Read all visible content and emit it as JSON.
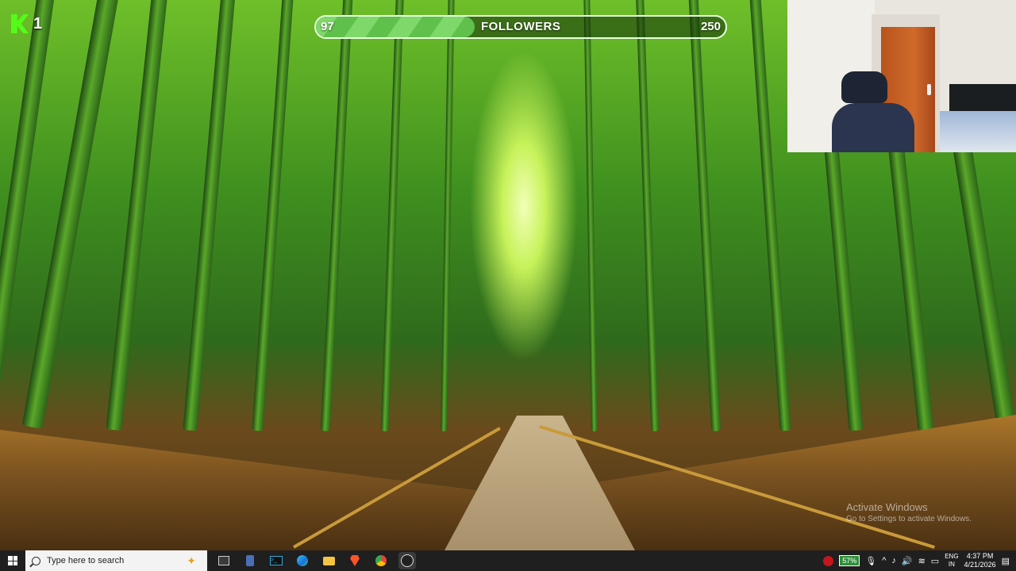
{
  "overlay": {
    "ticker_count": "1",
    "follower_goal": {
      "current": "97",
      "label": "FOLLOWERS",
      "target": "250",
      "progress_fraction": 0.388
    }
  },
  "watermark": {
    "title": "Activate Windows",
    "subtitle": "Go to Settings to activate Windows."
  },
  "taskbar": {
    "search_placeholder": "Type here to search",
    "pinned_apps": [
      "task-view-icon",
      "calculator-icon",
      "terminal-icon",
      "edge-icon",
      "file-explorer-icon",
      "brave-icon",
      "chrome-icon",
      "obs-icon"
    ],
    "battery_percent": "57%",
    "language": {
      "line1": "ENG",
      "line2": "IN"
    },
    "time": "4:37 PM",
    "date": "4/21/2026"
  },
  "colors": {
    "accent_green": "#53fc18",
    "taskbar_bg": "#1f1f1f",
    "goal_fill": "#6ccc58"
  }
}
